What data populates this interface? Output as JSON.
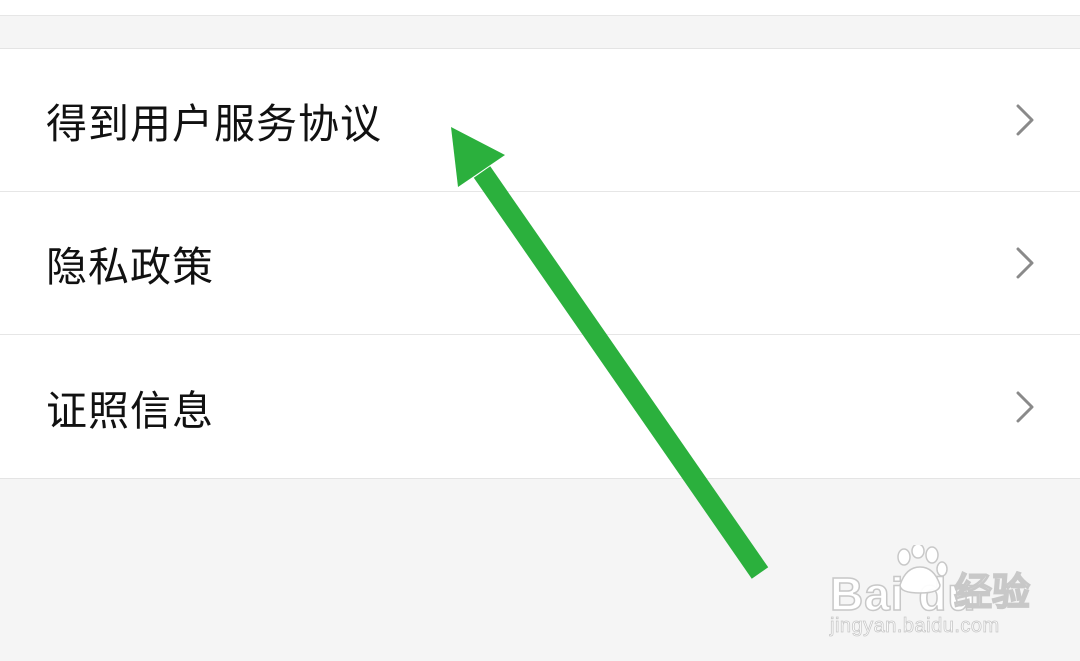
{
  "menu": {
    "items": [
      {
        "label": "得到用户服务协议",
        "icon": "chevron-right-icon"
      },
      {
        "label": "隐私政策",
        "icon": "chevron-right-icon"
      },
      {
        "label": "证照信息",
        "icon": "chevron-right-icon"
      }
    ]
  },
  "annotation": {
    "arrow_color": "#2bb03d",
    "icon": "arrow-annotation-icon"
  },
  "watermark": {
    "brand": "Bai  du",
    "product": "经验",
    "url": "jingyan.baidu.com",
    "icon": "baidu-paw-logo-icon"
  },
  "colors": {
    "background": "#f5f5f5",
    "row_background": "#ffffff",
    "text": "#111111",
    "chevron": "#8a8a8a",
    "divider": "#e6e6e6"
  }
}
